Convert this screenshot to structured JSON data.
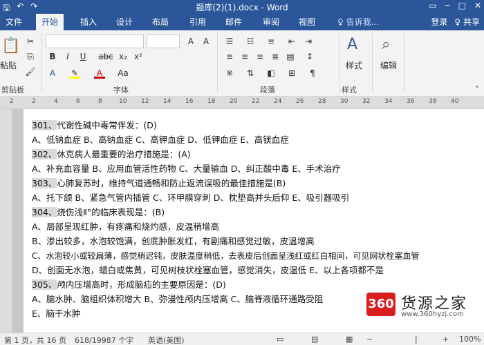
{
  "titlebar": {
    "title": "题库(2)(1).docx - Word",
    "qa_save_icon": "save-icon",
    "qa_undo_icon": "undo-icon",
    "qa_redo_icon": "redo-icon",
    "win_restore_icon": "restore-icon",
    "win_minimize_icon": "minimize-icon",
    "win_maximize_icon": "maximize-icon",
    "win_close_icon": "close-icon"
  },
  "tabs": {
    "items": [
      "文件",
      "开始",
      "插入",
      "设计",
      "布局",
      "引用",
      "邮件",
      "审阅",
      "视图"
    ],
    "active": "开始",
    "tell_me": "♀ 告诉我...",
    "signin": "登录",
    "share": "♀ 共享"
  },
  "ribbon": {
    "clipboard": {
      "paste": "粘贴",
      "label": "剪贴板"
    },
    "font": {
      "label": "字体"
    },
    "paragraph": {
      "label": "段落"
    },
    "styles": {
      "button": "样式",
      "label": "样式"
    },
    "editing": {
      "button": "编辑"
    }
  },
  "ruler": {
    "ticks": [
      "2",
      "2",
      "4",
      "6",
      "8",
      "10",
      "12",
      "14",
      "16",
      "18",
      "20",
      "22",
      "24",
      "26",
      "28",
      "30",
      "32",
      "34",
      "36",
      "38",
      "40"
    ]
  },
  "document": {
    "lines": [
      {
        "qnum": "301、",
        "text": "代谢性碱中毒常伴发：(D)"
      },
      {
        "qnum": "",
        "text": "A、低钠血症 B、高钠血症 C、高钾血症 D、低钾血症 E、高镁血症"
      },
      {
        "qnum": "302、",
        "text": "休克病人最重要的治疗措施是：(A)"
      },
      {
        "qnum": "",
        "text": "A、补充血容量   B、应用血管活性药物 C、大量输血 D、纠正酸中毒   E、手术治疗"
      },
      {
        "qnum": "303、",
        "text": "心肺复苏时，维持气道通畅和防止返流误吸的最佳措施是(B)"
      },
      {
        "qnum": "",
        "text": "A、托下颌   B、紧急气管内插管   C、环甲膜穿刺   D、枕垫高并头后仰   E、吸引器吸引"
      },
      {
        "qnum": "304、",
        "text": "烧伤浅Ⅱ°的临床表现是：(B)"
      },
      {
        "qnum": "",
        "text": "A、局部呈现红肿，有疼痛和烧灼感，皮温稍增高"
      },
      {
        "qnum": "",
        "text": "B、渗出较多，水泡较饱满，创底肿胀发红，有剧痛和感觉过敏，皮温增高"
      },
      {
        "qnum": "",
        "text": "C、水泡较小或较扁薄，感觉稍迟钝，皮肤温度稍低，去表皮后创面呈浅红或红白相间，可见网状栓塞血管"
      },
      {
        "qnum": "",
        "text": "D、创面无水泡，蜡白或焦黄，可见树枝状栓塞血管，感觉消失，皮温低 E、以上各项都不是"
      },
      {
        "qnum": "305、",
        "text": "颅内压增高时，形成脑疝的主要原因是：(D)"
      },
      {
        "qnum": "",
        "text": "A、脑水肿、脑组织体积增大   B、弥漫性颅内压增高 C、脑脊液循环通路受阻"
      },
      {
        "qnum": "",
        "text": "E、脑干水肿"
      }
    ]
  },
  "status": {
    "page": "第 1 页，共 16 页",
    "words": "618/19987 个字",
    "lang": "英语(美国)",
    "zoom": "100%"
  },
  "watermark": {
    "logo": "360",
    "name": "货源之家",
    "url": "www.360hyzj.com"
  },
  "colors": {
    "title_blue": "#2b579a",
    "ribbon_bg": "#f3f3f3",
    "highlight": "#d9d9d9",
    "logo_red": "#d91e1e"
  }
}
